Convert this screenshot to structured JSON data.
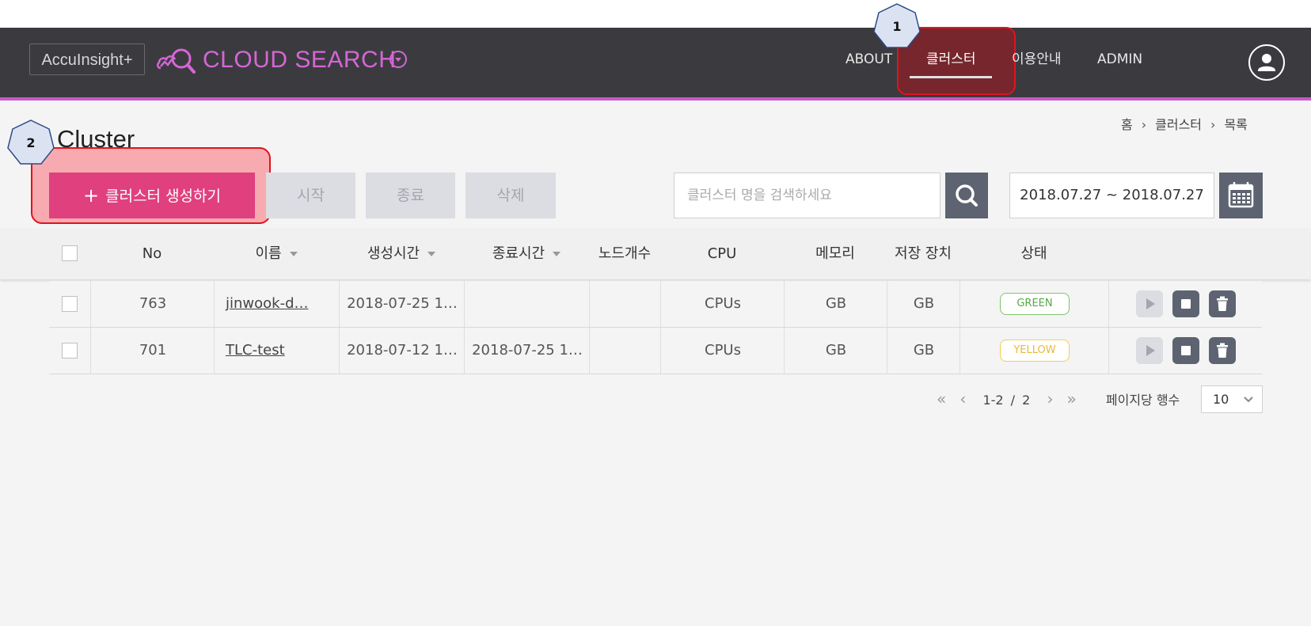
{
  "header": {
    "logo_text": "AccuInsight+",
    "brand": "CLOUD SEARCH",
    "nav": [
      {
        "label": "ABOUT"
      },
      {
        "label": "클러스터"
      },
      {
        "label": "이용안내"
      },
      {
        "label": "ADMIN"
      }
    ],
    "active_nav": "클러스터"
  },
  "annotations": {
    "badge_1": "1",
    "badge_2": "2"
  },
  "breadcrumb": [
    "홈",
    "클러스터",
    "목록"
  ],
  "page": {
    "title": "Cluster"
  },
  "toolbar": {
    "create_label": "클러스터 생성하기",
    "start_label": "시작",
    "stop_label": "종료",
    "delete_label": "삭제",
    "search_placeholder": "클러스터 명을 검색하세요",
    "date_range": "2018.07.27 ~ 2018.07.27"
  },
  "table": {
    "headers": {
      "no": "No",
      "name": "이름",
      "created": "생성시간",
      "ended": "종료시간",
      "nodes": "노드개수",
      "cpu": "CPU",
      "memory": "메모리",
      "storage": "저장 장치",
      "status": "상태"
    },
    "rows": [
      {
        "no": "763",
        "name": "jinwook-d…",
        "created": "2018-07-25 1…",
        "ended": "",
        "nodes": "",
        "cpu": "CPUs",
        "memory": "GB",
        "storage": "GB",
        "status": "GREEN"
      },
      {
        "no": "701",
        "name": "TLC-test",
        "created": "2018-07-12 1…",
        "ended": "2018-07-25 1…",
        "nodes": "",
        "cpu": "CPUs",
        "memory": "GB",
        "storage": "GB",
        "status": "YELLOW"
      }
    ]
  },
  "pagination": {
    "range": "1-2",
    "separator": "/",
    "total": "2",
    "per_page_label": "페이지당 행수",
    "per_page_value": "10"
  },
  "colors": {
    "navbar": "#3b3b3f",
    "brand": "#d566d5",
    "primary_button": "#e0407e",
    "annotation_highlight": "#e0141e",
    "status_green": "#57a843",
    "status_yellow": "#e8b93a"
  }
}
